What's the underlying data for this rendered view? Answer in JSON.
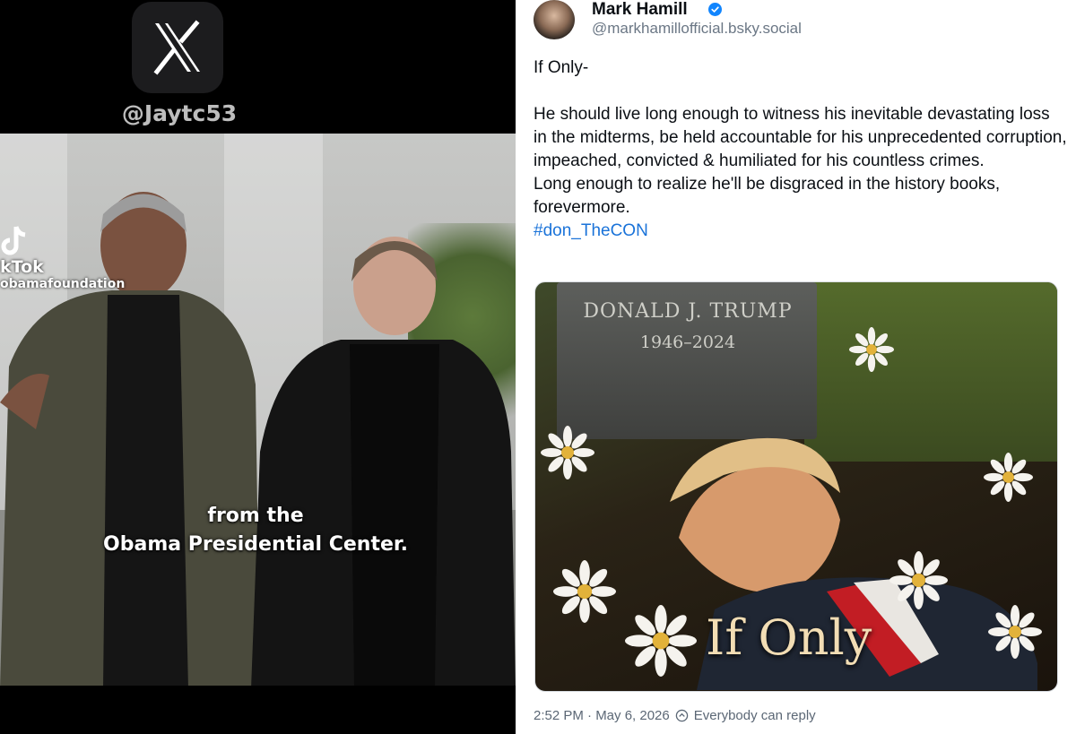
{
  "left_panel": {
    "logo_icon": "x-logo-icon",
    "watermark_handle": "@Jaytc53",
    "tiktok_watermark": {
      "app_name": "kTok",
      "username": "obamafoundation"
    },
    "video_caption": {
      "line1": "from the",
      "line2": "Obama Presidential Center."
    }
  },
  "post": {
    "author": {
      "display_name": "Mark Hamill",
      "verified_icon": "verified-check-icon",
      "handle": "@markhamillofficial.bsky.social"
    },
    "body": {
      "line1": "If Only-",
      "paragraph": "He should live long enough to witness his inevitable devastating loss in the midterms, be held accountable for his unprecedented corruption, impeached, convicted & humiliated for his countless crimes.",
      "paragraph2": "Long enough to realize he'll be disgraced in the history books, forevermore.",
      "hashtag": "#don_TheCON"
    },
    "image": {
      "headstone_name": "DONALD J. TRUMP",
      "headstone_dates": "1946–2024",
      "overlay_text": "If Only"
    },
    "meta": {
      "timestamp": "2:52 PM · May 6, 2026",
      "reply_icon": "reply-settings-icon",
      "reply_setting": "Everybody can reply"
    }
  },
  "colors": {
    "hashtag": "#1a73d9",
    "verified": "#1185fe",
    "meta_text": "#5b6775"
  }
}
